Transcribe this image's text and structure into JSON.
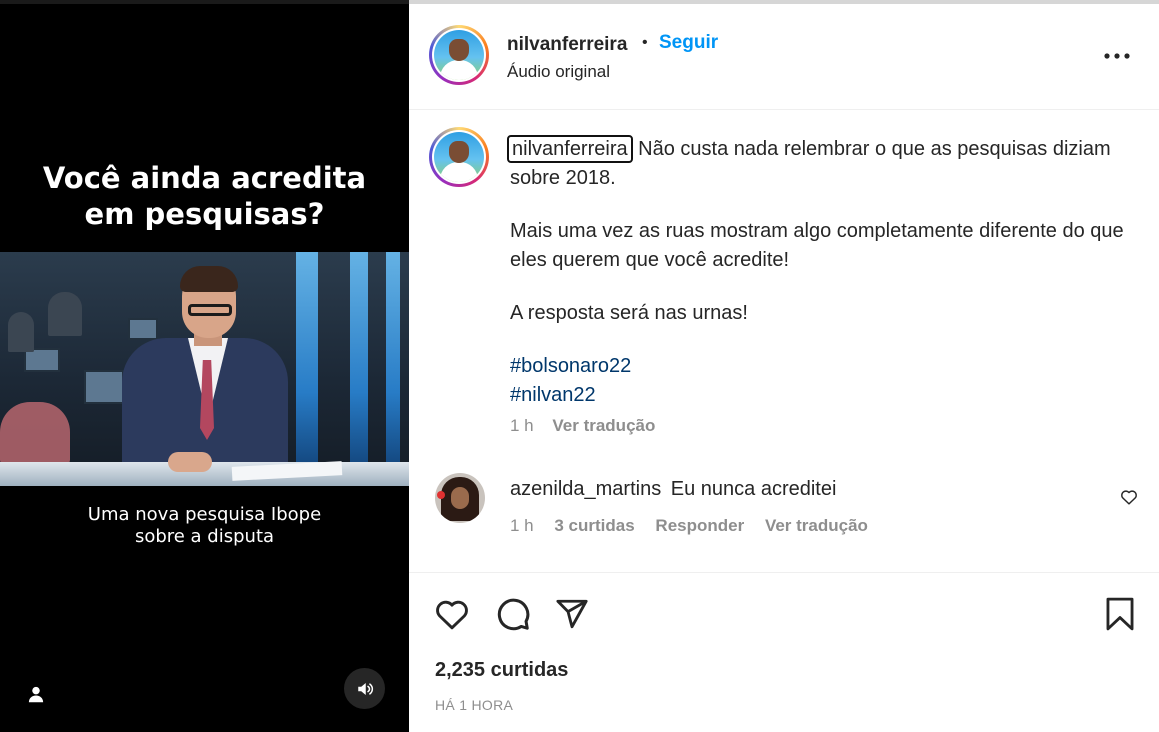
{
  "video": {
    "headline_line1": "Você ainda acredita",
    "headline_line2": "em pesquisas?",
    "caption_line1": "Uma nova pesquisa Ibope",
    "caption_line2": "sobre a disputa",
    "tag_icon": "user-icon",
    "sound_icon": "speaker-icon"
  },
  "header": {
    "username": "nilvanferreira",
    "separator": "•",
    "follow_label": "Seguir",
    "audio_label": "Áudio original",
    "more_icon": "more-horizontal-icon"
  },
  "caption": {
    "username": "nilvanferreira",
    "text_intro": "Não custa nada relembrar o que as pesquisas diziam sobre 2018.",
    "paragraph2": "Mais uma vez as ruas mostram algo completamente diferente do que eles querem que você acredite!",
    "paragraph3": "A resposta será nas urnas!",
    "hashtags": [
      "#bolsonaro22",
      "#nilvan22"
    ],
    "time": "1 h",
    "translate_label": "Ver tradução"
  },
  "comment": {
    "username": "azenilda_martins",
    "text": "Eu nunca acreditei",
    "time": "1 h",
    "likes": "3 curtidas",
    "reply_label": "Responder",
    "translate_label": "Ver tradução"
  },
  "actions": {
    "likes_count": "2,235 curtidas",
    "time_ago": "HÁ 1 HORA"
  },
  "colors": {
    "link_blue": "#0095f6",
    "hashtag_blue": "#00376b",
    "meta_gray": "#8e8e8e",
    "text": "#262626"
  }
}
